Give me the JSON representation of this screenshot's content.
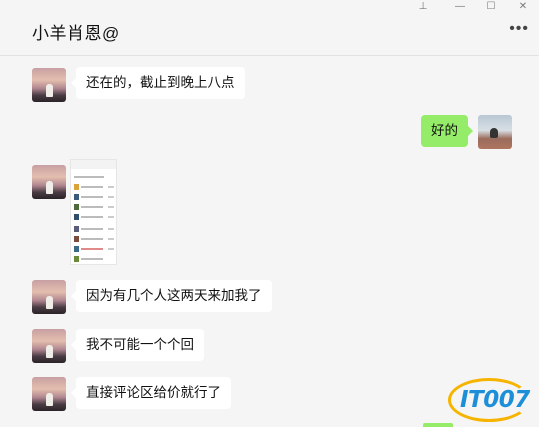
{
  "window": {
    "title": "小羊肖恩@",
    "pin_glyph": "⊥",
    "min_glyph": "—",
    "max_glyph": "☐",
    "close_glyph": "✕",
    "more_glyph": "•••"
  },
  "messages": [
    {
      "from": "other",
      "type": "text",
      "text": "还在的，截止到晚上八点"
    },
    {
      "from": "self",
      "type": "text",
      "text": "好的"
    },
    {
      "from": "other",
      "type": "image",
      "icon": "screenshot-thumbnail"
    },
    {
      "from": "other",
      "type": "text",
      "text": "因为有几个人这两天来加我了"
    },
    {
      "from": "other",
      "type": "text",
      "text": "我不可能一个个回"
    },
    {
      "from": "other",
      "type": "text",
      "text": "直接评论区给价就行了"
    }
  ],
  "watermark": {
    "text": "IT007",
    "colors": {
      "text": "#1d8fd8",
      "ring": "#f6b300"
    }
  },
  "colors": {
    "self_bubble": "#95ec69",
    "other_bubble": "#ffffff",
    "background": "#f5f5f5"
  }
}
